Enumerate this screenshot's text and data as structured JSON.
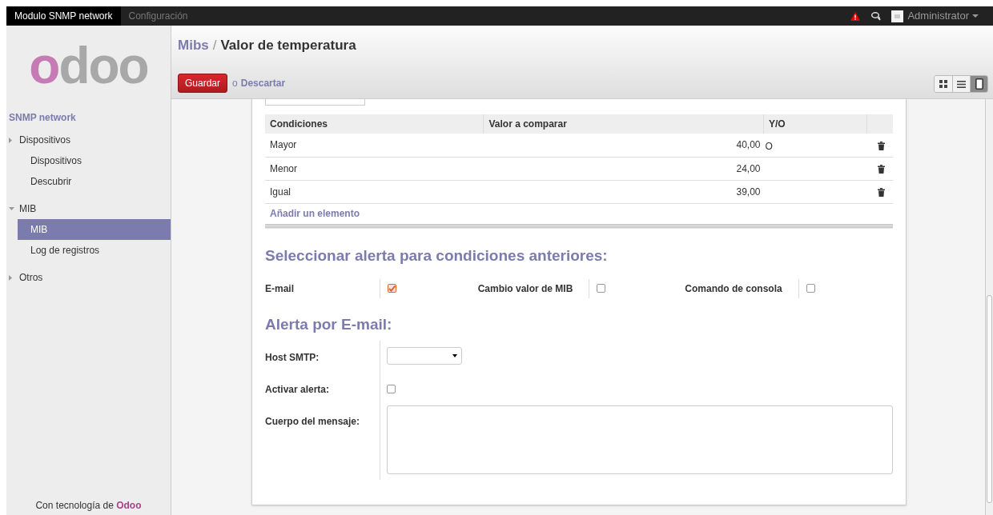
{
  "topbar": {
    "menus": [
      {
        "label": "Modulo SNMP network",
        "selected": true
      },
      {
        "label": "Configuración",
        "selected": false
      }
    ],
    "user": "Administrator"
  },
  "sidebar": {
    "logo": [
      "o",
      "doo"
    ],
    "title": "SNMP network",
    "items": [
      {
        "label": "Dispositivos",
        "expanded": false,
        "selected": false,
        "children": [
          {
            "label": "Dispositivos",
            "selected": false
          },
          {
            "label": "Descubrir",
            "selected": false
          }
        ]
      },
      {
        "label": "MIB",
        "expanded": true,
        "selected": false,
        "children": [
          {
            "label": "MIB",
            "selected": true
          },
          {
            "label": "Log de registros",
            "selected": false
          }
        ]
      },
      {
        "label": "Otros",
        "expanded": false,
        "selected": false
      }
    ],
    "footer": "Con tecnología de **Odoo**"
  },
  "breadcrumb": {
    "parent": "Mibs",
    "separator": "/",
    "current": "Valor de temperatura"
  },
  "actions": {
    "save": "Guardar",
    "or": "o",
    "discard": "Descartar"
  },
  "view_switcher": [
    {
      "kind": "kanban",
      "selected": false
    },
    {
      "kind": "list",
      "selected": false
    },
    {
      "kind": "form",
      "selected": true
    }
  ],
  "table": {
    "columns": [
      "Condiciones",
      "Valor a comparar",
      "Y/O"
    ],
    "rows": [
      {
        "condition": "Mayor",
        "value": "40,00",
        "y_o": "O"
      },
      {
        "condition": "Menor",
        "value": "24,00"
      },
      {
        "condition": "Igual",
        "value": "39,00"
      }
    ],
    "add": "Añadir un elemento"
  },
  "alert_section": {
    "title": "Seleccionar alerta para condiciones anteriores:",
    "options": [
      {
        "label": "E-mail",
        "checked": true
      },
      {
        "label": "Cambio valor de MIB",
        "checked": false
      },
      {
        "label": "Comando de consola",
        "checked": false
      }
    ]
  },
  "email_section": {
    "title": "Alerta por E-mail:",
    "fields": [
      {
        "kind": "select",
        "label": "Host SMTP:"
      },
      {
        "kind": "checkbox",
        "label": "Activar alerta:",
        "checked": false
      },
      {
        "kind": "textarea",
        "label": "Cuerpo del mensaje:"
      }
    ]
  }
}
